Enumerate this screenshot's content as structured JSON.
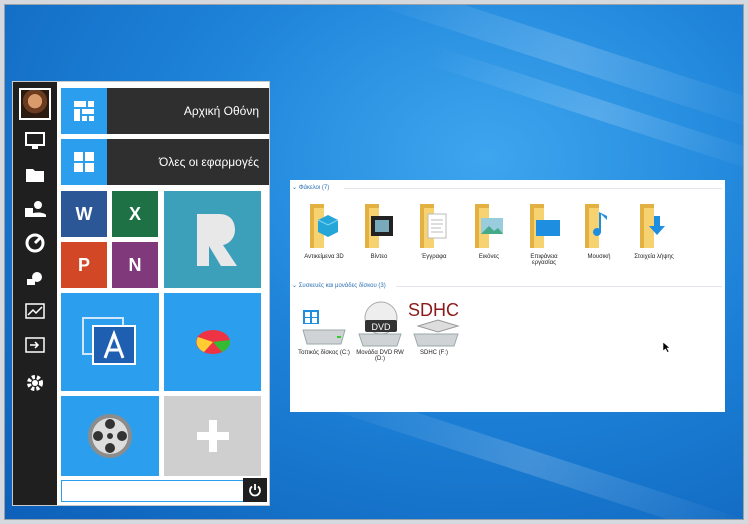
{
  "start_menu": {
    "home_label": "Αρχική Οθόνη",
    "all_apps_label": "Όλες οι εφαρμογές",
    "rail_icons": [
      "avatar",
      "monitor-icon",
      "folder-icon",
      "user-icon",
      "network-icon",
      "gear-wrench-icon",
      "chart-icon",
      "logout-icon",
      "settings-icon"
    ],
    "tiles": [
      "word-icon",
      "excel-icon",
      "powerpoint-icon",
      "onenote-icon",
      "readiris-icon",
      "acronis-icon",
      "disk-partition-icon",
      "film-reel-icon",
      "add-tile-icon"
    ],
    "search_placeholder": ""
  },
  "explorer": {
    "folders_header": "Φάκελοι (7)",
    "folders": [
      {
        "label": "Αντικείμενα 3D",
        "icon": "3d-objects-icon"
      },
      {
        "label": "Βίντεο",
        "icon": "videos-icon"
      },
      {
        "label": "Έγγραφα",
        "icon": "documents-icon"
      },
      {
        "label": "Εικόνες",
        "icon": "pictures-icon"
      },
      {
        "label": "Επιφάνεια εργασίας",
        "icon": "desktop-icon"
      },
      {
        "label": "Μουσική",
        "icon": "music-icon"
      },
      {
        "label": "Στοιχεία λήψης",
        "icon": "downloads-icon"
      }
    ],
    "drives_header": "Συσκευές και μονάδες δίσκου (3)",
    "drives": [
      {
        "label": "Τοπικός δίσκος (C:)",
        "icon": "local-disk-icon"
      },
      {
        "label": "Μονάδα DVD RW (D:)",
        "icon": "dvd-drive-icon",
        "badge": "DVD"
      },
      {
        "label": "SDHC (F:)",
        "icon": "sd-card-icon",
        "badge": "SDHC"
      }
    ]
  },
  "colors": {
    "accent": "#2b9fee",
    "tile_dark": "#2f2f2f",
    "folder": "#f6d270"
  }
}
